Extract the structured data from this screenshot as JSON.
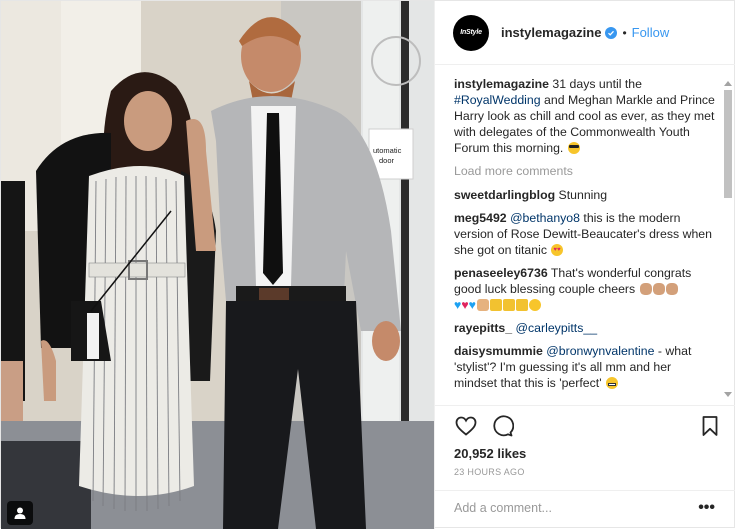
{
  "header": {
    "avatar_text": "InStyle",
    "username": "instylemagazine",
    "dot": "•",
    "follow_label": "Follow"
  },
  "photo": {
    "door_sign_line1": "utomatic",
    "door_sign_line2": "door"
  },
  "caption": {
    "username": "instylemagazine",
    "text_before": " 31 days until the ",
    "hashtag": "#RoyalWedding",
    "text_after": " and Meghan Markle and Prince Harry look as chill and cool as ever, as they met with delegates of the Commonwealth Youth Forum this morning. ",
    "emoji": "sunglasses-emoji"
  },
  "load_more_label": "Load more comments",
  "comments": [
    {
      "username": "sweetdarlingblog",
      "mention": "",
      "text": " Stunning",
      "emojis": []
    },
    {
      "username": "meg5492",
      "mention": "@bethanyo8",
      "text": " this is the modern version of Rose Dewitt-Beaucater's dress when she got on titanic ",
      "emojis": [
        "heart-eyes-emoji"
      ]
    },
    {
      "username": "penaseeley6736",
      "mention": "",
      "text": " That's wonderful congrats good luck blessing couple cheers ",
      "emojis": [
        "clap-emoji",
        "clap-emoji",
        "clap-emoji",
        "blue-heart-emoji",
        "red-heart-emoji",
        "blue-heart-emoji",
        "thumbs-up-emoji",
        "crown-emoji",
        "crown-emoji",
        "crown-emoji",
        "smile-emoji"
      ]
    },
    {
      "username": "raye.pitts_",
      "display_username": "rayepitts_",
      "mention": "@carleypitts__",
      "text": "",
      "emojis": []
    },
    {
      "username": "daisysmummie",
      "mention": "@bronwynvalentine",
      "text": " - what 'stylist'? I'm guessing it's all mm and her mindset that this is 'perfect' ",
      "emojis": [
        "grimace-emoji"
      ]
    }
  ],
  "actions": {
    "likes": "20,952 likes",
    "time": "23 HOURS AGO",
    "comment_placeholder": "Add a comment...",
    "more_options": "•••"
  },
  "colors": {
    "link_blue": "#3897f0",
    "mention_blue": "#003569",
    "muted_gray": "#999999",
    "text": "#262626"
  }
}
